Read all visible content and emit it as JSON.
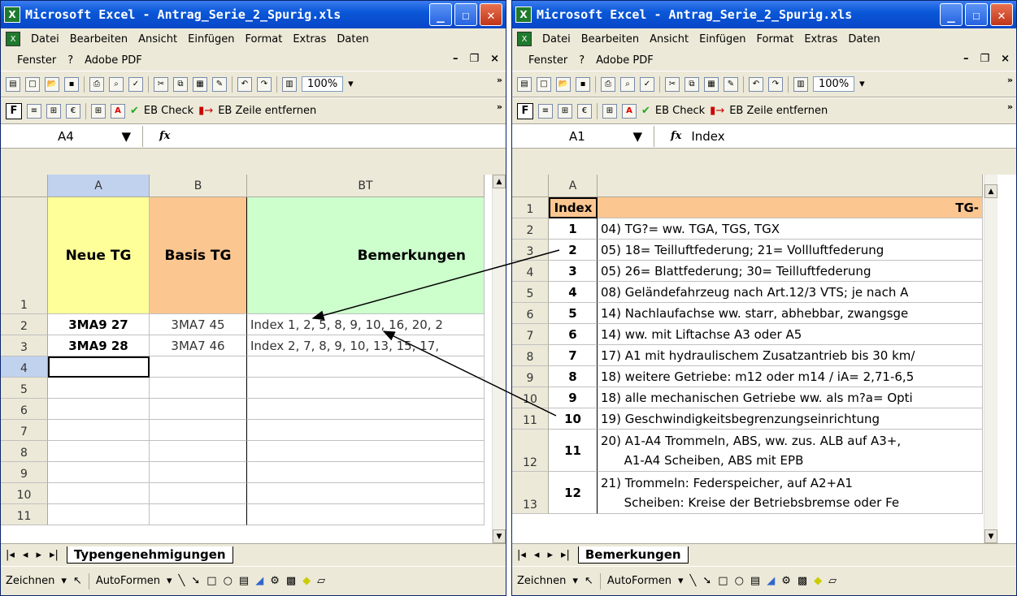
{
  "left": {
    "title": "Microsoft Excel - Antrag_Serie_2_Spurig.xls",
    "menu1": [
      "Datei",
      "Bearbeiten",
      "Ansicht",
      "Einfügen",
      "Format",
      "Extras",
      "Daten"
    ],
    "menu2": [
      "Fenster",
      "?",
      "Adobe PDF"
    ],
    "zoom": "100%",
    "eb_check": "EB Check",
    "eb_remove": "EB Zeile entfernen",
    "name_box": "A4",
    "formula": "",
    "col_headers": [
      "A",
      "B",
      "BT"
    ],
    "header_cells": [
      "Neue TG",
      "Basis TG",
      "Bemerkungen"
    ],
    "rows": [
      {
        "num": "1"
      },
      {
        "num": "2",
        "a": "3MA9 27",
        "b": "3MA7 45",
        "c": "Index 1, 2, 5, 8, 9, 10, 16, 20, 2"
      },
      {
        "num": "3",
        "a": "3MA9 28",
        "b": "3MA7 46",
        "c": "Index 2, 7, 8, 9, 10, 13, 15, 17,"
      },
      {
        "num": "4"
      },
      {
        "num": "5"
      },
      {
        "num": "6"
      },
      {
        "num": "7"
      },
      {
        "num": "8"
      },
      {
        "num": "9"
      },
      {
        "num": "10"
      },
      {
        "num": "11"
      }
    ],
    "sheet_tab": "Typengenehmigungen",
    "draw": "Zeichnen",
    "autoshapes": "AutoFormen"
  },
  "right": {
    "title": "Microsoft Excel - Antrag_Serie_2_Spurig.xls",
    "menu1": [
      "Datei",
      "Bearbeiten",
      "Ansicht",
      "Einfügen",
      "Format",
      "Extras",
      "Daten"
    ],
    "menu2": [
      "Fenster",
      "?",
      "Adobe PDF"
    ],
    "zoom": "100%",
    "eb_check": "EB Check",
    "eb_remove": "EB Zeile entfernen",
    "name_box": "A1",
    "formula": "Index",
    "col_header": "A",
    "rows": [
      {
        "num": "1",
        "a": "Index",
        "b": "TG-"
      },
      {
        "num": "2",
        "a": "1",
        "b": "04) TG?= ww. TGA, TGS, TGX"
      },
      {
        "num": "3",
        "a": "2",
        "b": "05) 18= Teilluftfederung;  21= Vollluftfederung"
      },
      {
        "num": "4",
        "a": "3",
        "b": "05) 26= Blattfederung;  30= Teilluftfederung"
      },
      {
        "num": "5",
        "a": "4",
        "b": "08) Geländefahrzeug nach Art.12/3 VTS; je nach A"
      },
      {
        "num": "6",
        "a": "5",
        "b": "14) Nachlaufachse ww. starr, abhebbar, zwangsge"
      },
      {
        "num": "7",
        "a": "6",
        "b": "14) ww. mit Liftachse A3 oder A5"
      },
      {
        "num": "8",
        "a": "7",
        "b": "17) A1 mit hydraulischem Zusatzantrieb bis 30 km/"
      },
      {
        "num": "9",
        "a": "8",
        "b": "18) weitere Getriebe: m12 oder m14 / iA= 2,71-6,5"
      },
      {
        "num": "10",
        "a": "9",
        "b": "18) alle mechanischen Getriebe ww. als m?a= Opti"
      },
      {
        "num": "11",
        "a": "10",
        "b": "19) Geschwindigkeitsbegrenzungseinrichtung"
      },
      {
        "num": "12",
        "a": "11",
        "b": "20) A1-A4 Trommeln, ABS, ww. zus. ALB auf A3+,",
        "b2": "      A1-A4 Scheiben, ABS mit EPB"
      },
      {
        "num": "13",
        "a": "12",
        "b": "21) Trommeln: Federspeicher, auf A2+A1",
        "b2": "      Scheiben: Kreise der Betriebsbremse oder Fe"
      }
    ],
    "sheet_tab": "Bemerkungen",
    "draw": "Zeichnen",
    "autoshapes": "AutoFormen"
  },
  "colors": {
    "yellow": "#ffff99",
    "orange": "#fbc690",
    "green": "#ccffcc",
    "title_blue": "#0a58d8"
  }
}
